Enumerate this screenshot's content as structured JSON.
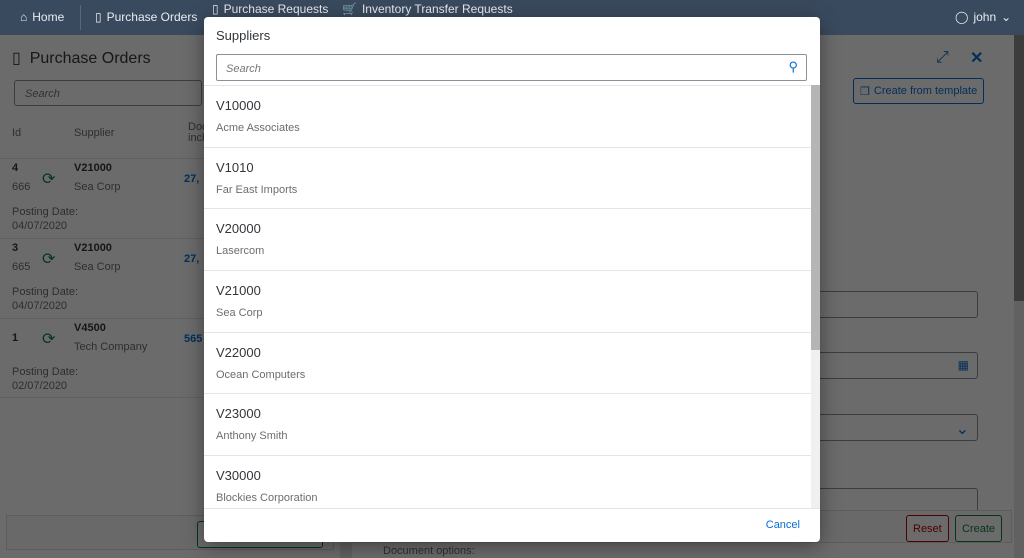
{
  "nav": {
    "items": [
      {
        "label": "Home",
        "icon": "home-icon"
      },
      {
        "label": "Purchase Orders",
        "icon": "document-icon"
      },
      {
        "label": "Purchase Requests",
        "icon": "document-icon"
      },
      {
        "label": "Inventory Transfer Requests",
        "icon": "cart-icon"
      }
    ],
    "user": "john"
  },
  "left": {
    "title": "Purchase Orders",
    "search_placeholder": "Search",
    "columns": [
      "Id",
      "Supplier",
      "Doc. incl."
    ],
    "rows": [
      {
        "id": "4",
        "num": "666",
        "code": "V21000",
        "name": "Sea Corp",
        "amount": "27,",
        "posting_label": "Posting Date:",
        "date": "04/07/2020"
      },
      {
        "id": "3",
        "num": "665",
        "code": "V21000",
        "name": "Sea Corp",
        "amount": "27,",
        "posting_label": "Posting Date:",
        "date": "04/07/2020"
      },
      {
        "id": "1",
        "num": "",
        "code": "V4500",
        "name": "Tech Company",
        "amount": "565",
        "posting_label": "Posting Date:",
        "date": "02/07/2020"
      }
    ]
  },
  "right": {
    "create_from_template": "Create from template",
    "reset": "Reset",
    "create": "Create",
    "document_options": "Document options:"
  },
  "dialog": {
    "title": "Suppliers",
    "search_placeholder": "Search",
    "cancel": "Cancel",
    "items": [
      {
        "code": "V10000",
        "name": "Acme Associates"
      },
      {
        "code": "V1010",
        "name": "Far East Imports"
      },
      {
        "code": "V20000",
        "name": "Lasercom"
      },
      {
        "code": "V21000",
        "name": "Sea Corp"
      },
      {
        "code": "V22000",
        "name": "Ocean Computers"
      },
      {
        "code": "V23000",
        "name": "Anthony Smith"
      },
      {
        "code": "V30000",
        "name": "Blockies Corporation"
      }
    ]
  },
  "colors": {
    "nav": "#1b2636",
    "accent": "#0a6ed1",
    "reset": "#bb0000",
    "create": "#107e3e",
    "sync": "#107e3e"
  }
}
